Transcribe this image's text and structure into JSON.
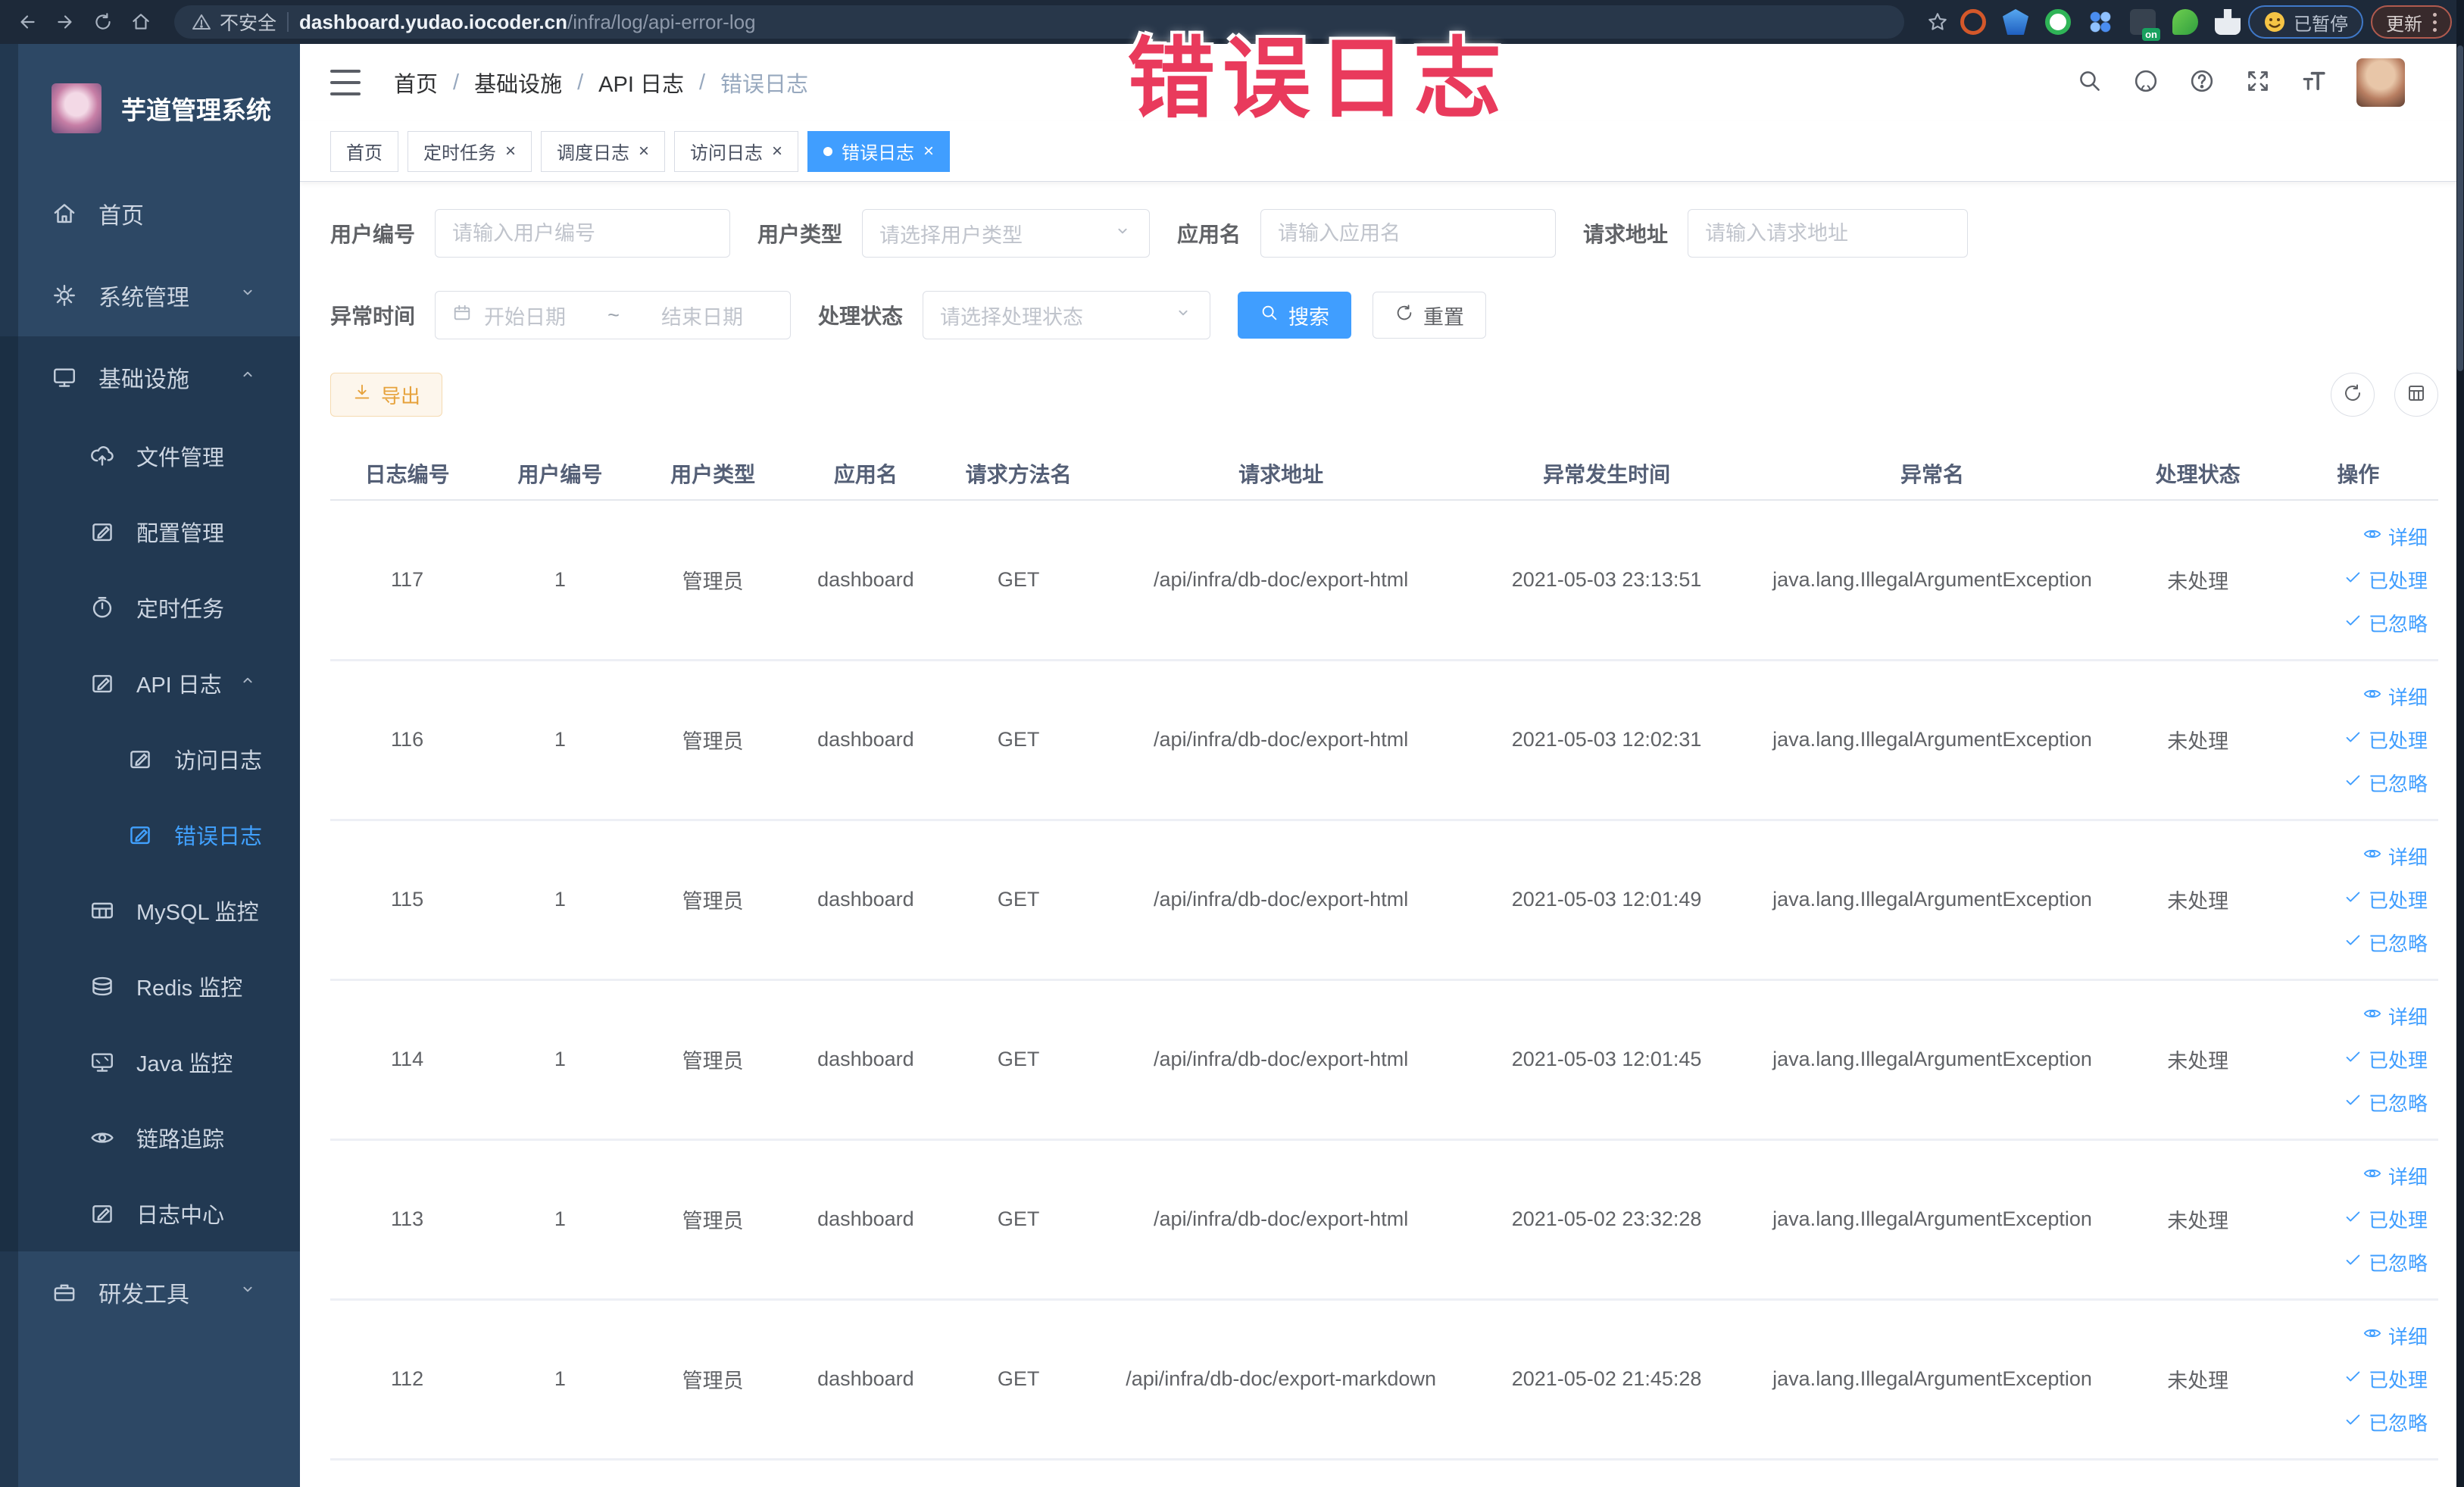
{
  "browser": {
    "security_label": "不安全",
    "url_host": "dashboard.yudao.iocoder.cn",
    "url_path": "/infra/log/api-error-log",
    "profile_badge": "已暂停",
    "update_button": "更新"
  },
  "stamp": {
    "text": "错误日志"
  },
  "sidebar": {
    "title": "芋道管理系统",
    "items": [
      {
        "name": "home",
        "label": "首页",
        "icon": "home",
        "depth": 0,
        "dark": false,
        "active": false,
        "chevron": ""
      },
      {
        "name": "system-mgmt",
        "label": "系统管理",
        "icon": "gear",
        "depth": 0,
        "dark": false,
        "active": false,
        "chevron": "down"
      },
      {
        "name": "infrastructure",
        "label": "基础设施",
        "icon": "monitor",
        "depth": 0,
        "dark": true,
        "active": false,
        "chevron": "up"
      },
      {
        "name": "file-mgmt",
        "label": "文件管理",
        "icon": "upload",
        "depth": 1,
        "dark": true,
        "active": false,
        "chevron": ""
      },
      {
        "name": "config-mgmt",
        "label": "配置管理",
        "icon": "edit",
        "depth": 1,
        "dark": true,
        "active": false,
        "chevron": ""
      },
      {
        "name": "scheduled-jobs",
        "label": "定时任务",
        "icon": "timer",
        "depth": 1,
        "dark": true,
        "active": false,
        "chevron": ""
      },
      {
        "name": "api-log",
        "label": "API 日志",
        "icon": "logsq",
        "depth": 1,
        "dark": true,
        "active": false,
        "chevron": "up"
      },
      {
        "name": "access-log",
        "label": "访问日志",
        "icon": "logsq",
        "depth": 2,
        "dark": true,
        "active": false,
        "chevron": ""
      },
      {
        "name": "error-log",
        "label": "错误日志",
        "icon": "logsq",
        "depth": 2,
        "dark": true,
        "active": true,
        "chevron": ""
      },
      {
        "name": "mysql-monitor",
        "label": "MySQL 监控",
        "icon": "db",
        "depth": 1,
        "dark": true,
        "active": false,
        "chevron": ""
      },
      {
        "name": "redis-monitor",
        "label": "Redis 监控",
        "icon": "layers",
        "depth": 1,
        "dark": true,
        "active": false,
        "chevron": ""
      },
      {
        "name": "java-monitor",
        "label": "Java 监控",
        "icon": "screen",
        "depth": 1,
        "dark": true,
        "active": false,
        "chevron": ""
      },
      {
        "name": "trace",
        "label": "链路追踪",
        "icon": "eye",
        "depth": 1,
        "dark": true,
        "active": false,
        "chevron": ""
      },
      {
        "name": "log-center",
        "label": "日志中心",
        "icon": "logsq",
        "depth": 1,
        "dark": true,
        "active": false,
        "chevron": ""
      },
      {
        "name": "dev-tools",
        "label": "研发工具",
        "icon": "brief",
        "depth": 0,
        "dark": false,
        "active": false,
        "chevron": "down"
      }
    ]
  },
  "breadcrumb": {
    "items": [
      "首页",
      "基础设施",
      "API 日志",
      "错误日志"
    ]
  },
  "tabs": [
    {
      "label": "首页",
      "closable": false,
      "active": false
    },
    {
      "label": "定时任务",
      "closable": true,
      "active": false
    },
    {
      "label": "调度日志",
      "closable": true,
      "active": false
    },
    {
      "label": "访问日志",
      "closable": true,
      "active": false
    },
    {
      "label": "错误日志",
      "closable": true,
      "active": true
    }
  ],
  "filters": {
    "user_id_label": "用户编号",
    "user_id_placeholder": "请输入用户编号",
    "user_type_label": "用户类型",
    "user_type_placeholder": "请选择用户类型",
    "app_name_label": "应用名",
    "app_name_placeholder": "请输入应用名",
    "request_url_label": "请求地址",
    "request_url_placeholder": "请输入请求地址",
    "exception_time_label": "异常时间",
    "date_start_placeholder": "开始日期",
    "date_separator": "~",
    "date_end_placeholder": "结束日期",
    "process_status_label": "处理状态",
    "process_status_placeholder": "请选择处理状态",
    "search_button": "搜索",
    "reset_button": "重置"
  },
  "toolbar": {
    "export_button": "导出"
  },
  "table": {
    "columns": [
      "日志编号",
      "用户编号",
      "用户类型",
      "应用名",
      "请求方法名",
      "请求地址",
      "异常发生时间",
      "异常名",
      "处理状态",
      "操作"
    ],
    "col_widths": [
      "7.3%",
      "7.2%",
      "7.3%",
      "7.2%",
      "7.3%",
      "17.6%",
      "13.3%",
      "17.6%",
      "7.6%",
      "7.6%"
    ],
    "actions": {
      "detail": "详细",
      "processed": "已处理",
      "ignored": "已忽略"
    },
    "rows": [
      {
        "id": "117",
        "user_id": "1",
        "user_type": "管理员",
        "app": "dashboard",
        "method": "GET",
        "url": "/api/infra/db-doc/export-html",
        "time": "2021-05-03 23:13:51",
        "exception": "java.lang.IllegalArgumentException",
        "status": "未处理"
      },
      {
        "id": "116",
        "user_id": "1",
        "user_type": "管理员",
        "app": "dashboard",
        "method": "GET",
        "url": "/api/infra/db-doc/export-html",
        "time": "2021-05-03 12:02:31",
        "exception": "java.lang.IllegalArgumentException",
        "status": "未处理"
      },
      {
        "id": "115",
        "user_id": "1",
        "user_type": "管理员",
        "app": "dashboard",
        "method": "GET",
        "url": "/api/infra/db-doc/export-html",
        "time": "2021-05-03 12:01:49",
        "exception": "java.lang.IllegalArgumentException",
        "status": "未处理"
      },
      {
        "id": "114",
        "user_id": "1",
        "user_type": "管理员",
        "app": "dashboard",
        "method": "GET",
        "url": "/api/infra/db-doc/export-html",
        "time": "2021-05-03 12:01:45",
        "exception": "java.lang.IllegalArgumentException",
        "status": "未处理"
      },
      {
        "id": "113",
        "user_id": "1",
        "user_type": "管理员",
        "app": "dashboard",
        "method": "GET",
        "url": "/api/infra/db-doc/export-html",
        "time": "2021-05-02 23:32:28",
        "exception": "java.lang.IllegalArgumentException",
        "status": "未处理"
      },
      {
        "id": "112",
        "user_id": "1",
        "user_type": "管理员",
        "app": "dashboard",
        "method": "GET",
        "url": "/api/infra/db-doc/export-markdown",
        "time": "2021-05-02 21:45:28",
        "exception": "java.lang.IllegalArgumentException",
        "status": "未处理"
      }
    ]
  }
}
